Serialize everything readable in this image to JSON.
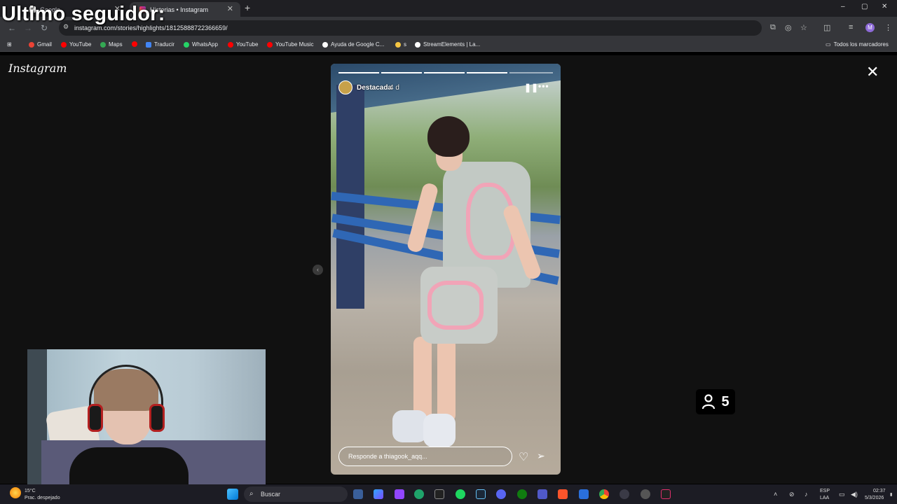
{
  "overlay": {
    "title": "Ultimo seguidor:"
  },
  "browser": {
    "tabs": [
      {
        "label": "Google",
        "active": false
      },
      {
        "label": "Historias • Instagram",
        "active": true
      }
    ],
    "new_tab_icon": "+",
    "window_controls": {
      "minimize": "–",
      "maximize": "▢",
      "close": "✕"
    },
    "url": "instagram.com/stories/highlights/18125888722366659/",
    "bookmarks": [
      {
        "label": "Gmail",
        "color": "#ea4335"
      },
      {
        "label": "YouTube",
        "color": "#ff0000"
      },
      {
        "label": "Maps",
        "color": "#34a853"
      },
      {
        "label": "",
        "color": "#ff0000"
      },
      {
        "label": "Traducir",
        "color": "#4285f4"
      },
      {
        "label": "WhatsApp",
        "color": "#25d366"
      },
      {
        "label": "YouTube",
        "color": "#ff0000"
      },
      {
        "label": "YouTube Music",
        "color": "#ff0000"
      },
      {
        "label": "Ayuda de Google C...",
        "color": "#ffffff"
      },
      {
        "label": "s",
        "color": "#f5c542"
      },
      {
        "label": "StreamElements | La...",
        "color": "#ffffff"
      }
    ],
    "all_bookmarks": "Todos los marcadores",
    "profile_initial": "M"
  },
  "instagram": {
    "logo": "Instagram",
    "close_icon": "✕",
    "story": {
      "username": "Destacada",
      "time": "4 d",
      "pause_icon": "❚❚",
      "more_icon": "•••",
      "progress_total": 5,
      "progress_current": 5,
      "reply_placeholder": "Responde a thiagook_aqq...",
      "prev_icon": "‹"
    }
  },
  "viewer_counter": {
    "value": "5"
  },
  "taskbar": {
    "weather_temp": "15°C",
    "weather_desc": "Prac. despejado",
    "search_label": "Buscar",
    "lang_top": "ESP",
    "lang_bottom": "LAA",
    "time": "02:37",
    "date": "5/3/2026"
  }
}
